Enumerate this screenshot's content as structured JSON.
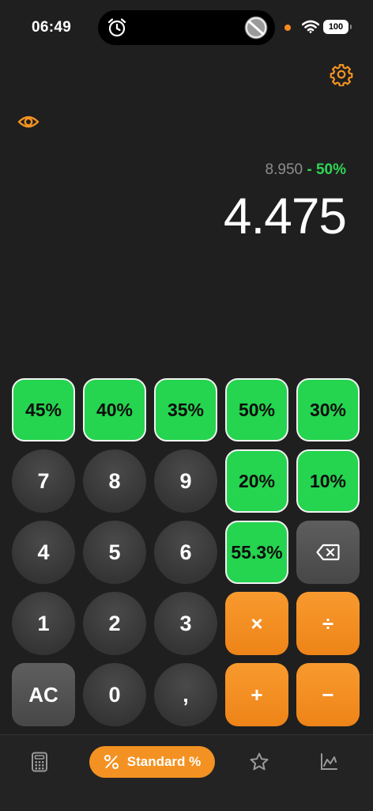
{
  "status_bar": {
    "time": "06:49",
    "battery": "100"
  },
  "display": {
    "expression_base": "8.950",
    "expression_pct": " - 50%",
    "result": "4.475"
  },
  "keypad": {
    "row1": [
      "45%",
      "40%",
      "35%",
      "50%",
      "30%"
    ],
    "row2": [
      "7",
      "8",
      "9",
      "20%",
      "10%"
    ],
    "row3": [
      "4",
      "5",
      "6",
      "55.3%"
    ],
    "row4": [
      "1",
      "2",
      "3",
      "×",
      "÷"
    ],
    "row5": [
      "AC",
      "0",
      ",",
      "+",
      "−"
    ]
  },
  "tabbar": {
    "standard_label": "Standard %"
  },
  "colors": {
    "accent": "#f39222",
    "percent_green": "#25d44f",
    "background": "#1f1f1f"
  },
  "icons": {
    "alarm": "alarm-clock-icon",
    "dial": "dial-icon",
    "wifi": "wifi-icon",
    "settings": "gear-icon",
    "visibility": "eye-icon",
    "backspace": "backspace-icon",
    "calculator": "calculator-icon",
    "percent": "percent-icon",
    "favorites": "star-icon",
    "chart": "chart-icon"
  }
}
